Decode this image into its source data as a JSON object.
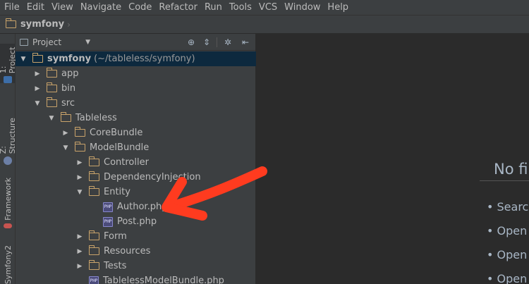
{
  "menu": [
    "File",
    "Edit",
    "View",
    "Navigate",
    "Code",
    "Refactor",
    "Run",
    "Tools",
    "VCS",
    "Window",
    "Help"
  ],
  "navbar": {
    "project": "symfony"
  },
  "side_tabs": [
    {
      "label": "1: Project",
      "top": 0
    },
    {
      "label": "Z: Structure"
    },
    {
      "label": "Framework"
    },
    {
      "label": "Symfony2"
    }
  ],
  "panel": {
    "selector_label": "Project"
  },
  "tree": [
    {
      "label": "symfony",
      "extra": "(~/tableless/symfony)",
      "type": "folder",
      "state": "open",
      "depth": 0,
      "selected": true
    },
    {
      "label": "app",
      "type": "folder",
      "state": "closed",
      "depth": 1
    },
    {
      "label": "bin",
      "type": "folder",
      "state": "closed",
      "depth": 1
    },
    {
      "label": "src",
      "type": "folder",
      "state": "open",
      "depth": 1
    },
    {
      "label": "Tableless",
      "type": "folder",
      "state": "open",
      "depth": 2
    },
    {
      "label": "CoreBundle",
      "type": "folder",
      "state": "closed",
      "depth": 3
    },
    {
      "label": "ModelBundle",
      "type": "folder",
      "state": "open",
      "depth": 3
    },
    {
      "label": "Controller",
      "type": "folder",
      "state": "closed",
      "depth": 4
    },
    {
      "label": "DependencyInjection",
      "type": "folder",
      "state": "closed",
      "depth": 4
    },
    {
      "label": "Entity",
      "type": "folder",
      "state": "open",
      "depth": 4
    },
    {
      "label": "Author.php",
      "type": "file",
      "depth": 5
    },
    {
      "label": "Post.php",
      "type": "file",
      "depth": 5
    },
    {
      "label": "Form",
      "type": "folder",
      "state": "closed",
      "depth": 4
    },
    {
      "label": "Resources",
      "type": "folder",
      "state": "closed",
      "depth": 4
    },
    {
      "label": "Tests",
      "type": "folder",
      "state": "closed",
      "depth": 4
    },
    {
      "label": "TablelessModelBundle.php",
      "type": "file",
      "depth": 4
    }
  ],
  "editor": {
    "title": "No fi",
    "tips": [
      "• Search",
      "• Open a",
      "• Open",
      "• Open"
    ]
  },
  "colors": {
    "annotation_arrow": "#ff3b1f",
    "folder": "#c9a36a",
    "selection": "#0d293e"
  }
}
